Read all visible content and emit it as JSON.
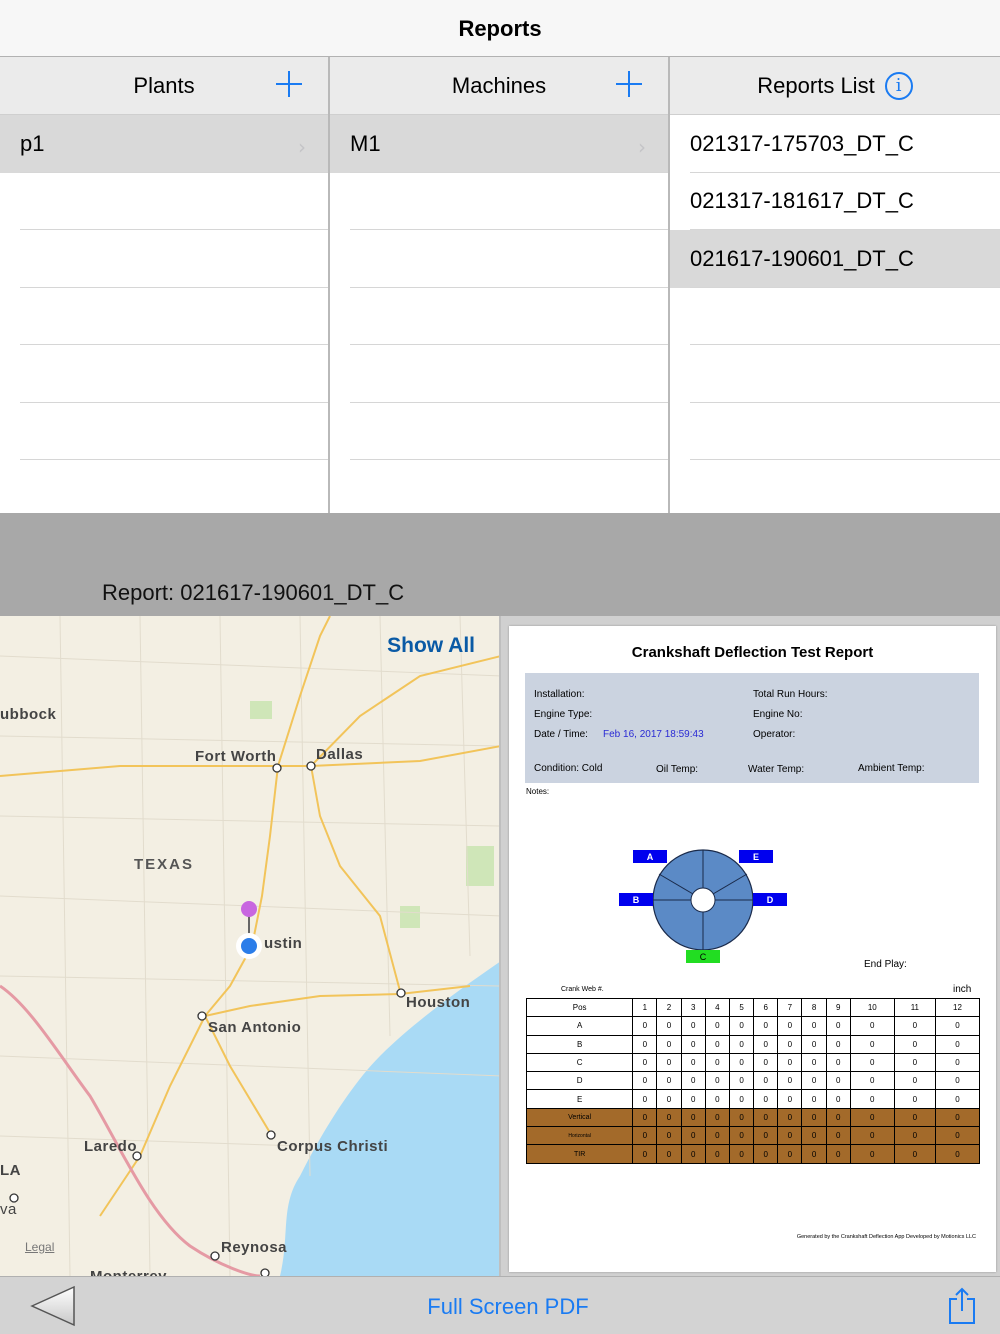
{
  "nav": {
    "title": "Reports"
  },
  "plants": {
    "header": "Plants",
    "items": [
      {
        "label": "p1",
        "selected": true
      }
    ]
  },
  "machines": {
    "header": "Machines",
    "items": [
      {
        "label": "M1",
        "selected": true
      }
    ]
  },
  "reports": {
    "header": "Reports List",
    "items": [
      {
        "label": "021317-175703_DT_C",
        "selected": false
      },
      {
        "label": "021317-181617_DT_C",
        "selected": false
      },
      {
        "label": "021617-190601_DT_C",
        "selected": true
      }
    ]
  },
  "detail": {
    "report_label": "Report: 021617-190601_DT_C"
  },
  "map": {
    "show_all": "Show All",
    "legal": "Legal",
    "labels": {
      "lubbock": "ubbock",
      "fort_worth": "Fort Worth",
      "dallas": "Dallas",
      "texas": "TEXAS",
      "austin": "ustin",
      "houston": "Houston",
      "san_antonio": "San Antonio",
      "laredo": "Laredo",
      "corpus": "Corpus Christi",
      "reynosa": "Reynosa",
      "la": "LA",
      "va": "va",
      "monterrey": "Monterrey"
    }
  },
  "pdf": {
    "title": "Crankshaft Deflection Test Report",
    "installation": "Installation:",
    "engine_type": "Engine Type:",
    "date_label": "Date / Time:",
    "date_value": "Feb 16, 2017 18:59:43",
    "total_hours": "Total Run Hours:",
    "engine_no": "Engine No:",
    "operator": "Operator:",
    "condition": "Condition: Cold",
    "oil_temp": "Oil Temp:",
    "water_temp": "Water Temp:",
    "ambient_temp": "Ambient Temp:",
    "notes": "Notes:",
    "end_play": "End Play:",
    "crank_web": "Crank Web #.",
    "unit": "inch",
    "diagram_labels": {
      "a": "A",
      "b": "B",
      "c": "C",
      "d": "D",
      "e": "E"
    },
    "table": {
      "header": [
        "Pos",
        "1",
        "2",
        "3",
        "4",
        "5",
        "6",
        "7",
        "8",
        "9",
        "10",
        "11",
        "12"
      ],
      "rows": [
        [
          "A",
          "0",
          "0",
          "0",
          "0",
          "0",
          "0",
          "0",
          "0",
          "0",
          "0",
          "0",
          "0"
        ],
        [
          "B",
          "0",
          "0",
          "0",
          "0",
          "0",
          "0",
          "0",
          "0",
          "0",
          "0",
          "0",
          "0"
        ],
        [
          "C",
          "0",
          "0",
          "0",
          "0",
          "0",
          "0",
          "0",
          "0",
          "0",
          "0",
          "0",
          "0"
        ],
        [
          "D",
          "0",
          "0",
          "0",
          "0",
          "0",
          "0",
          "0",
          "0",
          "0",
          "0",
          "0",
          "0"
        ],
        [
          "E",
          "0",
          "0",
          "0",
          "0",
          "0",
          "0",
          "0",
          "0",
          "0",
          "0",
          "0",
          "0"
        ]
      ],
      "summary_rows": [
        [
          "Vertical",
          "0",
          "0",
          "0",
          "0",
          "0",
          "0",
          "0",
          "0",
          "0",
          "0",
          "0",
          "0"
        ],
        [
          "Horizontal",
          "0",
          "0",
          "0",
          "0",
          "0",
          "0",
          "0",
          "0",
          "0",
          "0",
          "0",
          "0"
        ],
        [
          "TIR",
          "0",
          "0",
          "0",
          "0",
          "0",
          "0",
          "0",
          "0",
          "0",
          "0",
          "0",
          "0"
        ]
      ]
    },
    "footer": "Generated by the Crankshaft Deflection App Developed by Motionics LLC"
  },
  "toolbar": {
    "full_screen": "Full Screen PDF",
    "back_icon": "back-triangle-icon",
    "share_icon": "share-icon"
  },
  "colors": {
    "accent": "#1a7bf2",
    "selected_row": "#d9d9d9",
    "info_box": "#cbd3e0",
    "summary_row": "#a36a2a",
    "marker_blue": "#0000ee",
    "marker_green": "#22dd22",
    "wheel": "#5b8ac6"
  }
}
